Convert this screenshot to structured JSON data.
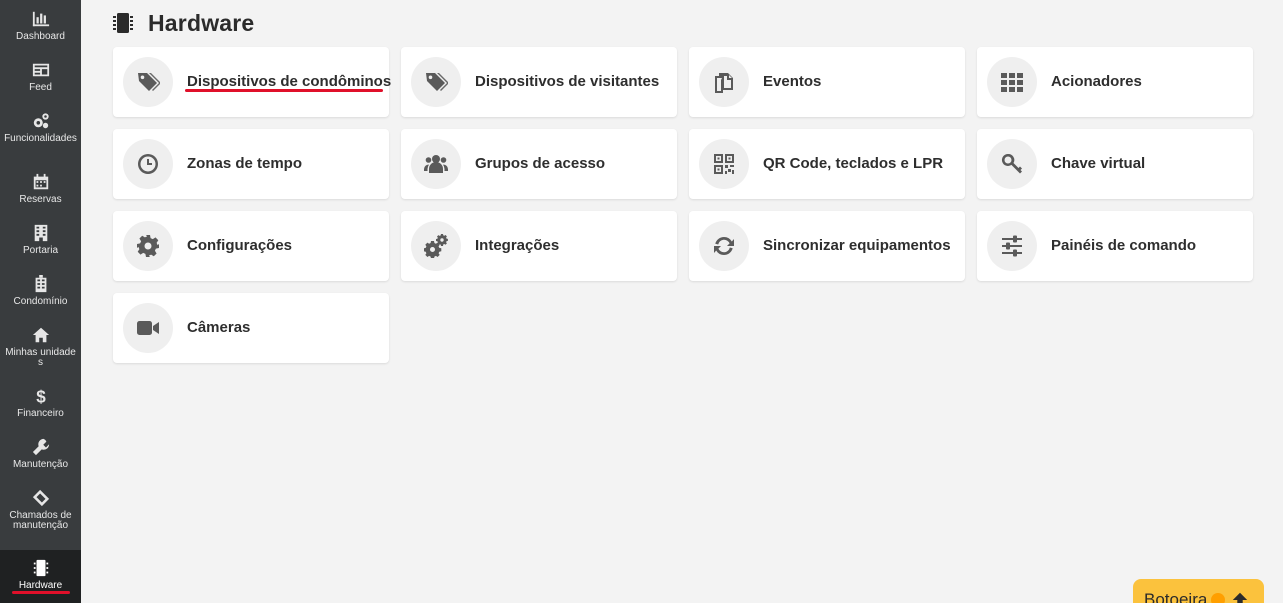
{
  "sidebar": {
    "items": [
      {
        "label": "Dashboard",
        "icon": "bar-chart-icon"
      },
      {
        "label": "Feed",
        "icon": "newspaper-icon"
      },
      {
        "label": "Funcionalidades",
        "icon": "gears-icon"
      },
      {
        "label": "Reservas",
        "icon": "calendar-icon"
      },
      {
        "label": "Portaria",
        "icon": "building-icon"
      },
      {
        "label": "Condomínio",
        "icon": "apartment-icon"
      },
      {
        "label": "Minhas unidades",
        "icon": "home-icon"
      },
      {
        "label": "Financeiro",
        "icon": "dollar-icon"
      },
      {
        "label": "Manutenção",
        "icon": "wrench-icon"
      },
      {
        "label": "Chamados de manutenção",
        "icon": "ticket-icon"
      },
      {
        "label": "Hardware",
        "icon": "chip-icon"
      }
    ],
    "active": "Hardware"
  },
  "header": {
    "title": "Hardware",
    "icon": "chip-icon"
  },
  "cards": [
    {
      "label": "Dispositivos de condôminos",
      "icon": "tag-icon"
    },
    {
      "label": "Dispositivos de visitantes",
      "icon": "tag-icon"
    },
    {
      "label": "Eventos",
      "icon": "copy-icon"
    },
    {
      "label": "Acionadores",
      "icon": "grid-icon"
    },
    {
      "label": "Zonas de tempo",
      "icon": "clock-icon"
    },
    {
      "label": "Grupos de acesso",
      "icon": "users-icon"
    },
    {
      "label": "QR Code, teclados e LPR",
      "icon": "qrcode-icon"
    },
    {
      "label": "Chave virtual",
      "icon": "key-icon"
    },
    {
      "label": "Configurações",
      "icon": "gear-icon"
    },
    {
      "label": "Integrações",
      "icon": "gears-icon"
    },
    {
      "label": "Sincronizar equipamentos",
      "icon": "sync-icon"
    },
    {
      "label": "Painéis de comando",
      "icon": "sliders-icon"
    },
    {
      "label": "Câmeras",
      "icon": "video-camera-icon"
    }
  ],
  "botoeira": {
    "label": "Botoeira"
  },
  "colors": {
    "sidebar": "#393c3e",
    "accent_underline": "#e0102a",
    "botoeira": "#fbc23d"
  }
}
